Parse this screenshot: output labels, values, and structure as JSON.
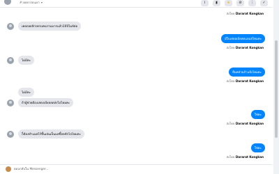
{
  "header": {
    "tag_label": "#วอยคาสอนเยา",
    "chevron_icon": "chevron-down-icon",
    "buttons": [
      {
        "icon": "info-icon",
        "glyph": "i"
      },
      {
        "icon": "trash-icon",
        "glyph": "🗑"
      },
      {
        "icon": "star-icon",
        "glyph": "★"
      },
      {
        "icon": "block-icon",
        "glyph": "⊘"
      },
      {
        "icon": "more-icon",
        "glyph": "⋮"
      },
      {
        "icon": "check-icon",
        "glyph": "✓"
      }
    ],
    "colors": {
      "star": "#f7b928"
    }
  },
  "messages": {
    "sent_by_prefix": "ส่งโดย",
    "sender_name": "Dararat Kongkan",
    "m1_sent_by": "ส่งโดย",
    "m1_sender": "Dararat Kongkan",
    "in1": "เคยถอยจักรครบคนรามมากแล้ว10ปีไมล์ต่อ",
    "out1": "มีใบเสลอเบียลดแลแส่ไหมคะ",
    "out1_sent_by": "ส่งโดย",
    "out1_sender": "Dararat Kongkan",
    "in2": "ไม่มีคะ",
    "out2": "ยืนคส่วนก้าแจ้งไหมคะ",
    "out2_sent_by": "ส่งโดย",
    "out2_sender": "Dararat Kongkan",
    "in3": "ไม่มีคะ",
    "in4": "ถ้าผู้ช่วยต้องเสดงเบียลลดส่งไปไหมคะ",
    "out3": "ใช่คะ",
    "out3_sent_by": "ส่งโดย",
    "out3_sender": "Dararat Kongkan",
    "in5": "ก็ต้องทำแมลไร้ขึ้นเล่นเป็นแลขึ้อหลักไปไหมคะ",
    "out4": "ใช่คะ",
    "out4_sent_by": "ส่งโดย",
    "out4_sender": "Dararat Kongkan"
  },
  "composer": {
    "placeholder": "ตอบกลับใน Messenger..."
  },
  "colors": {
    "outgoing_bubble": "#0084ff",
    "incoming_bubble": "#e4e6eb"
  }
}
